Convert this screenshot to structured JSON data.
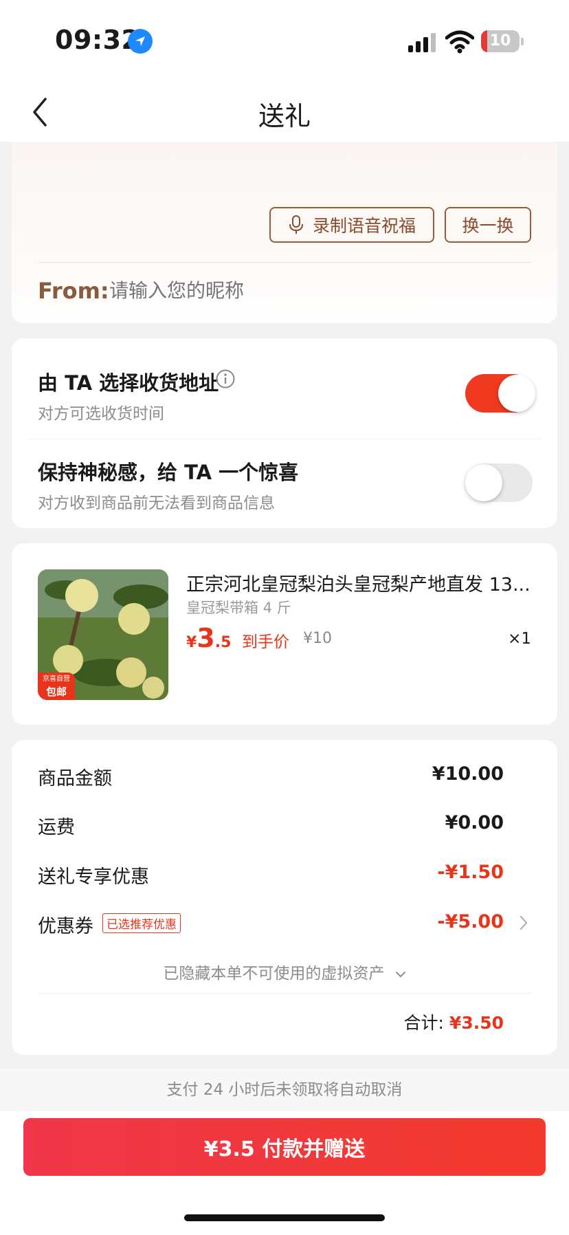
{
  "status_bar": {
    "time": "09:32",
    "battery": "10"
  },
  "nav": {
    "title": "送礼"
  },
  "greeting": {
    "voice_button": "录制语音祝福",
    "swap_button": "换一换",
    "from_label": "From:",
    "from_placeholder": "请输入您的昵称"
  },
  "options": [
    {
      "title": "由 TA 选择收货地址",
      "subtitle": "对方可选收货时间",
      "enabled": true
    },
    {
      "title": "保持神秘感，给 TA 一个惊喜",
      "subtitle": "对方收到商品前无法看到商品信息",
      "enabled": false
    }
  ],
  "product": {
    "title": "正宗河北皇冠梨泊头皇冠梨产地直发 13...",
    "spec": "皇冠梨带箱 4 斤",
    "badge_top": "京喜自营",
    "badge_bottom": "包邮",
    "price_symbol": "¥",
    "price_int": "3",
    "price_dec": ".5",
    "price_note": "到手价",
    "orig_price": "¥10",
    "qty": "×1"
  },
  "summary": {
    "rows": [
      {
        "label": "商品金额",
        "value": "¥10.00",
        "red": false
      },
      {
        "label": "运费",
        "value": "¥0.00",
        "red": false
      },
      {
        "label": "送礼专享优惠",
        "value": "-¥1.50",
        "red": true
      },
      {
        "label": "优惠券",
        "value": "-¥5.00",
        "red": true,
        "tag": "已选推荐优惠"
      }
    ],
    "hidden_note": "已隐藏本单不可使用的虚拟资产",
    "total_label": "合计:",
    "total_value": "¥3.50"
  },
  "footer": {
    "notice": "支付 24 小时后未领取将自动取消",
    "pay_button": "¥3.5 付款并赠送"
  },
  "colors": {
    "accent": "#ef3a1f",
    "brown": "#8a4b2d"
  }
}
